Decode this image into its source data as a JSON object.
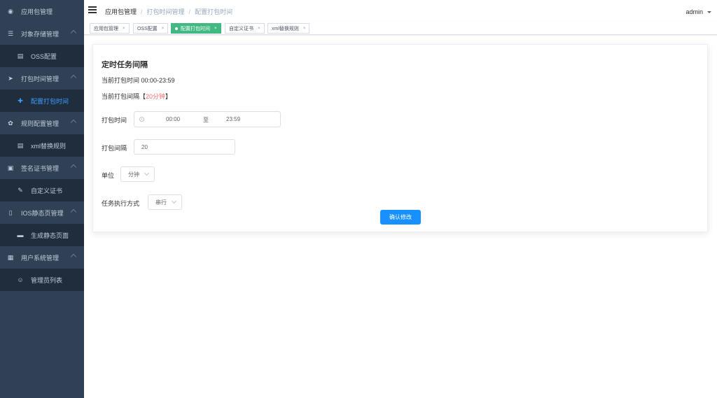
{
  "sidebar": {
    "items": [
      {
        "label": "应用包管理",
        "icon": "dashboard-icon",
        "glyph": "◉"
      },
      {
        "label": "对象存储管理",
        "icon": "list-icon",
        "glyph": "☰"
      },
      {
        "label": "OSS配置",
        "icon": "document-icon",
        "glyph": "▤"
      },
      {
        "label": "打包时间管理",
        "icon": "send-icon",
        "glyph": "➤"
      },
      {
        "label": "配置打包时间",
        "icon": "plus-icon",
        "glyph": "✚"
      },
      {
        "label": "规则配置管理",
        "icon": "gear-icon",
        "glyph": "✿"
      },
      {
        "label": "xml替换规则",
        "icon": "document-icon",
        "glyph": "▤"
      },
      {
        "label": "签名证书管理",
        "icon": "certificate-icon",
        "glyph": "▣"
      },
      {
        "label": "自定义证书",
        "icon": "edit-icon",
        "glyph": "✎"
      },
      {
        "label": "IOS静态页管理",
        "icon": "page-icon",
        "glyph": "▯"
      },
      {
        "label": "生成静态页面",
        "icon": "chat-icon",
        "glyph": "▬"
      },
      {
        "label": "用户系统管理",
        "icon": "grid-icon",
        "glyph": "▦"
      },
      {
        "label": "管理员列表",
        "icon": "user-icon",
        "glyph": "☺"
      }
    ]
  },
  "navbar": {
    "breadcrumb": [
      "应用包管理",
      "打包时间管理",
      "配置打包时间"
    ],
    "separator": "/",
    "user": "admin"
  },
  "tags": [
    {
      "label": "应用包管理",
      "close": "×"
    },
    {
      "label": "OSS配置",
      "close": "×"
    },
    {
      "label": "配置打包时间",
      "close": "×"
    },
    {
      "label": "自定义证书",
      "close": "×"
    },
    {
      "label": "xml替换规则",
      "close": "×"
    }
  ],
  "form": {
    "title": "定时任务间隔",
    "current_time_text": "当前打包时间 00:00-23:59",
    "current_interval_prefix": "当前打包间隔【",
    "current_interval_value": "20分钟",
    "current_interval_suffix": "】",
    "time_label": "打包时间",
    "time_start": "00:00",
    "time_to": "至",
    "time_end": "23:59",
    "interval_label": "打包间隔",
    "interval_value": "20",
    "unit_label": "单位",
    "unit_value": "分钟",
    "mode_label": "任务执行方式",
    "mode_value": "串行",
    "submit": "确认修改"
  },
  "colors": {
    "sidebar_bg": "#304156",
    "submenu_bg": "#1f2d3d",
    "active_menu": "#409eff",
    "active_tag": "#42b983",
    "primary_button": "#1890ff",
    "highlight_text": "#f56c6c"
  }
}
